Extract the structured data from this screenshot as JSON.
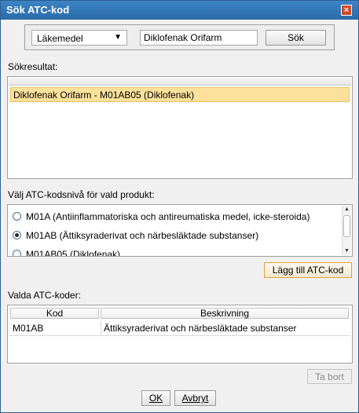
{
  "window": {
    "title": "Sök ATC-kod",
    "close_label": "×"
  },
  "search": {
    "type_select": "Läkemedel",
    "query": "Diklofenak Orifarm",
    "search_button": "Sök"
  },
  "results": {
    "label": "Sökresultat:",
    "items": [
      "Diklofenak Orifarm - M01AB05 (Diklofenak)"
    ]
  },
  "levels": {
    "label": "Välj ATC-kodsnivå för vald produkt:",
    "options": [
      {
        "label": "M01A (Antiinflammatoriska och antireumatiska medel, icke-steroida)",
        "checked": false
      },
      {
        "label": "M01AB (Ättiksyraderivat och närbesläktade substanser)",
        "checked": true
      },
      {
        "label": "M01AB05 (Diklofenak)",
        "checked": false
      }
    ],
    "add_button": "Lägg till ATC-kod"
  },
  "selected": {
    "label": "Valda ATC-koder:",
    "columns": [
      "Kod",
      "Beskrivning"
    ],
    "rows": [
      {
        "kod": "M01AB",
        "beskrivning": "Ättiksyraderivat och närbesläktade substanser"
      }
    ],
    "remove_button": "Ta bort"
  },
  "footer": {
    "ok_button": "OK",
    "cancel_button": "Avbryt"
  },
  "colors": {
    "title_bar": "#2f72b4",
    "selection": "#fbe19b",
    "accent_border": "#e0a040"
  }
}
